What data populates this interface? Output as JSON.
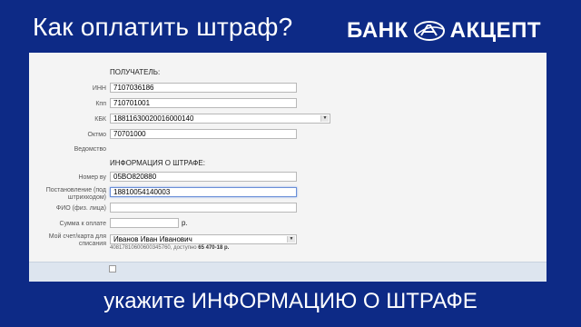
{
  "header": {
    "title": "Как оплатить штраф?",
    "logo_left": "БАНК",
    "logo_right": "АКЦЕПТ"
  },
  "form": {
    "recipient_title": "ПОЛУЧАТЕЛЬ:",
    "inn_label": "ИНН",
    "inn_value": "7107036186",
    "kpp_label": "Кпп",
    "kpp_value": "710701001",
    "kbk_label": "КБК",
    "kbk_value": "18811630020016000140",
    "oktmo_label": "Октмо",
    "oktmo_value": "70701000",
    "vedomstvo_label": "Ведомство",
    "fine_title": "ИНФОРМАЦИЯ О ШТРАФЕ:",
    "nomer_vu_label": "Номер ву",
    "nomer_vu_value": "05BO820880",
    "postanovlenie_label": "Постановление (под штрихкодом)",
    "postanovlenie_value": "18810054140003",
    "fio_label": "ФИО (физ. лица)",
    "fio_value": "",
    "sum_label": "Сумма к оплате",
    "sum_value": "",
    "sum_suffix": "р.",
    "account_label": "Мой счет/карта для списания",
    "account_value": "Иванов Иван Иванович",
    "account_number": "40817810600600345760, доступно",
    "account_balance": "65 470-18 р."
  },
  "caption": "укажите ИНФОРМАЦИЮ О ШТРАФЕ",
  "colors": {
    "brand_blue": "#0d2a86",
    "panel_bg": "#f4f4f4",
    "focus_border": "#6a8fd8"
  },
  "icons": {
    "dropdown": "chevron-down-icon",
    "logo_mark": "bank-logo-icon"
  }
}
